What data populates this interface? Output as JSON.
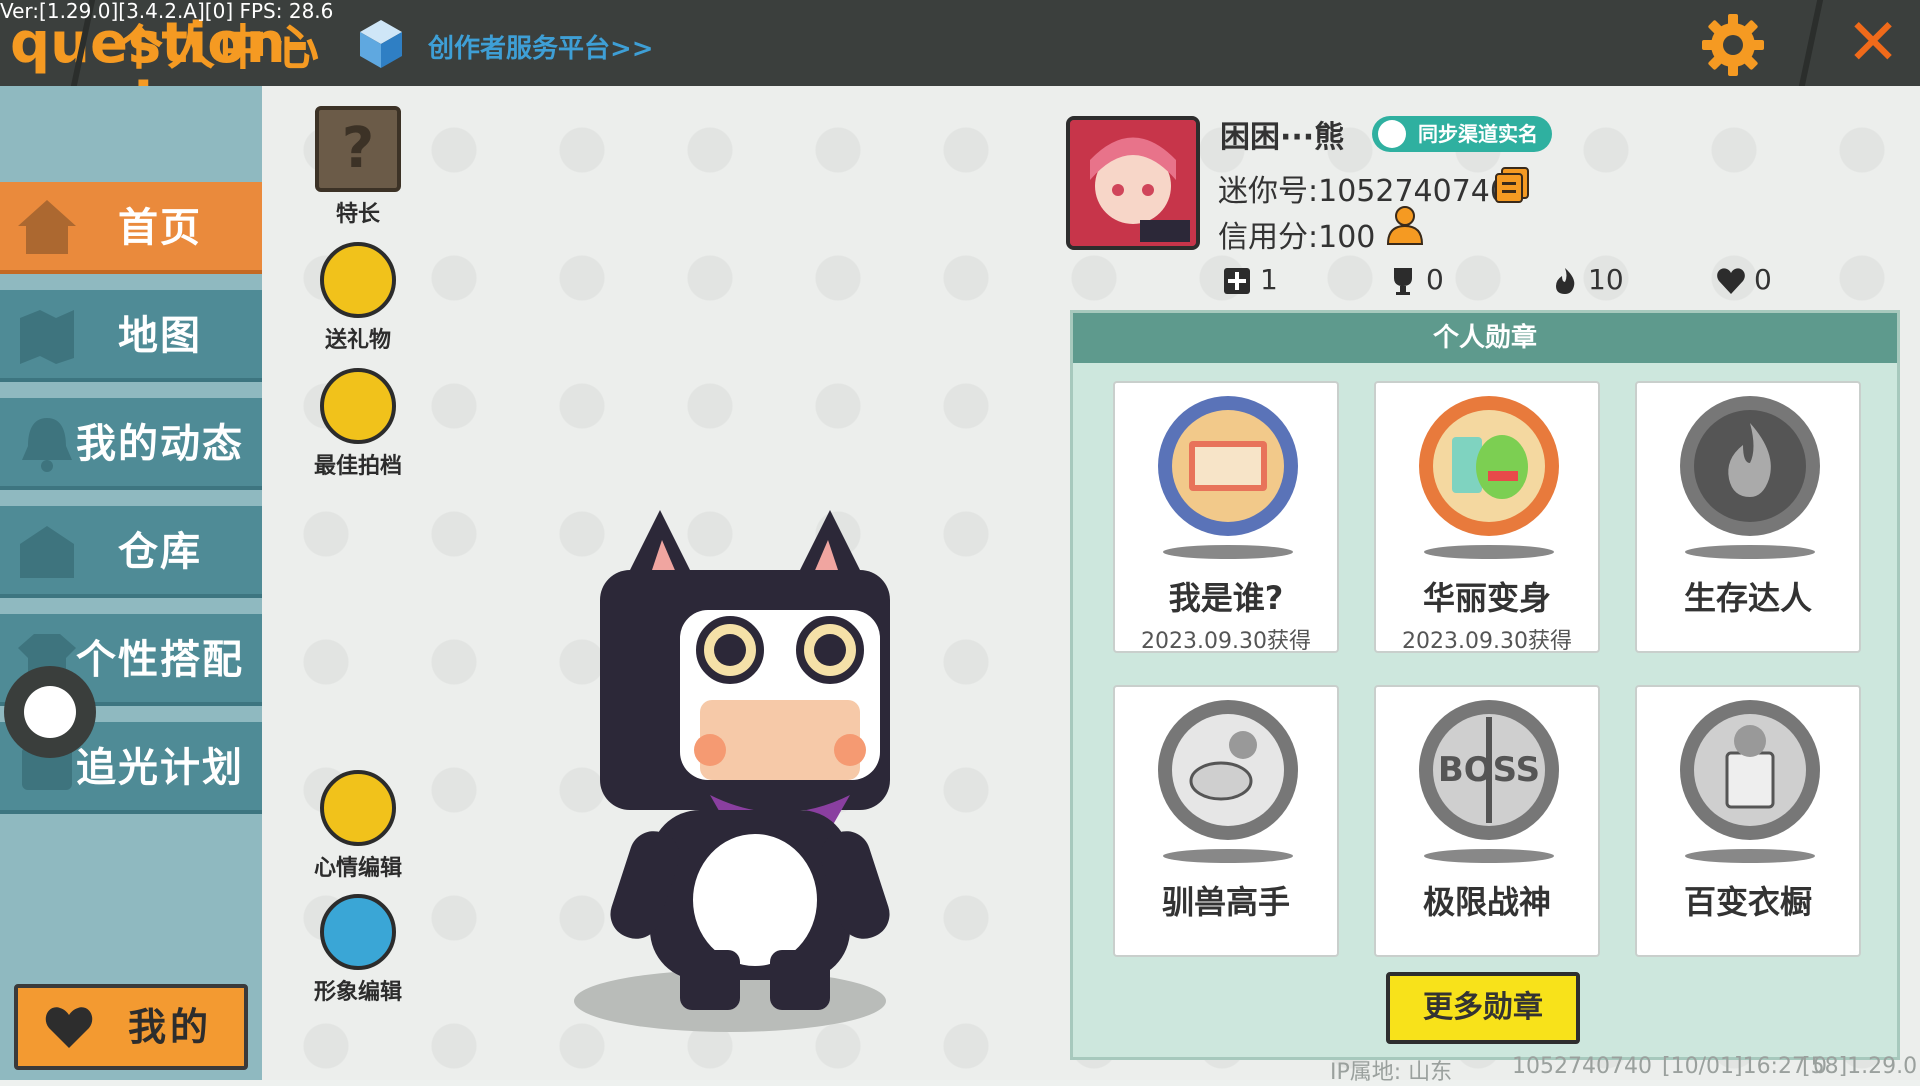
{
  "topbar": {
    "version_text": "Ver:[1.29.0][3.4.2.A][0] FPS: 28.6",
    "help_icon": "question-mark",
    "title": "个人中心",
    "creator_link": "创作者服务平台>>",
    "accent": "#f59a22"
  },
  "sidebar": {
    "items": [
      {
        "label": "首页",
        "icon": "house-icon",
        "active": true
      },
      {
        "label": "地图",
        "icon": "map-icon",
        "active": false
      },
      {
        "label": "我的动态",
        "icon": "bell-icon",
        "active": false
      },
      {
        "label": "仓库",
        "icon": "warehouse-icon",
        "active": false
      },
      {
        "label": "个性搭配",
        "icon": "outfit-icon",
        "active": false
      },
      {
        "label": "追光计划",
        "icon": "plan-icon",
        "active": false
      }
    ],
    "mine_button": "我的"
  },
  "actions": {
    "specialty": {
      "label": "特长",
      "icon": "?"
    },
    "send_gift": "送礼物",
    "best_partner": "最佳拍档",
    "mood_edit": "心情编辑",
    "avatar_edit": "形象编辑"
  },
  "profile": {
    "name": "困困···熊",
    "sync_badge": "同步渠道实名",
    "mini_id": "迷你号:1052740740",
    "credit": "信用分:100",
    "stats": [
      {
        "icon": "plus-flag-icon",
        "value": "1"
      },
      {
        "icon": "trophy-icon",
        "value": "0"
      },
      {
        "icon": "flame-icon",
        "value": "10"
      },
      {
        "icon": "heart-icon",
        "value": "0"
      }
    ]
  },
  "medals": {
    "title": "个人勋章",
    "items": [
      {
        "name": "我是谁?",
        "date": "2023.09.30获得",
        "unlocked": true,
        "color": "#5a73b8"
      },
      {
        "name": "华丽变身",
        "date": "2023.09.30获得",
        "unlocked": true,
        "color": "#e87a3c"
      },
      {
        "name": "生存达人",
        "date": "",
        "unlocked": false,
        "color": "#777777"
      },
      {
        "name": "驯兽高手",
        "date": "",
        "unlocked": false,
        "color": "#777777"
      },
      {
        "name": "极限战神",
        "date": "",
        "unlocked": false,
        "color": "#777777"
      },
      {
        "name": "百变衣橱",
        "date": "",
        "unlocked": false,
        "color": "#777777"
      }
    ],
    "more_button": "更多勋章"
  },
  "footer": {
    "ip": "IP属地: 山东",
    "id": "1052740740",
    "time": "[10/01]16:27 0",
    "build": "[58]1.29.0"
  }
}
